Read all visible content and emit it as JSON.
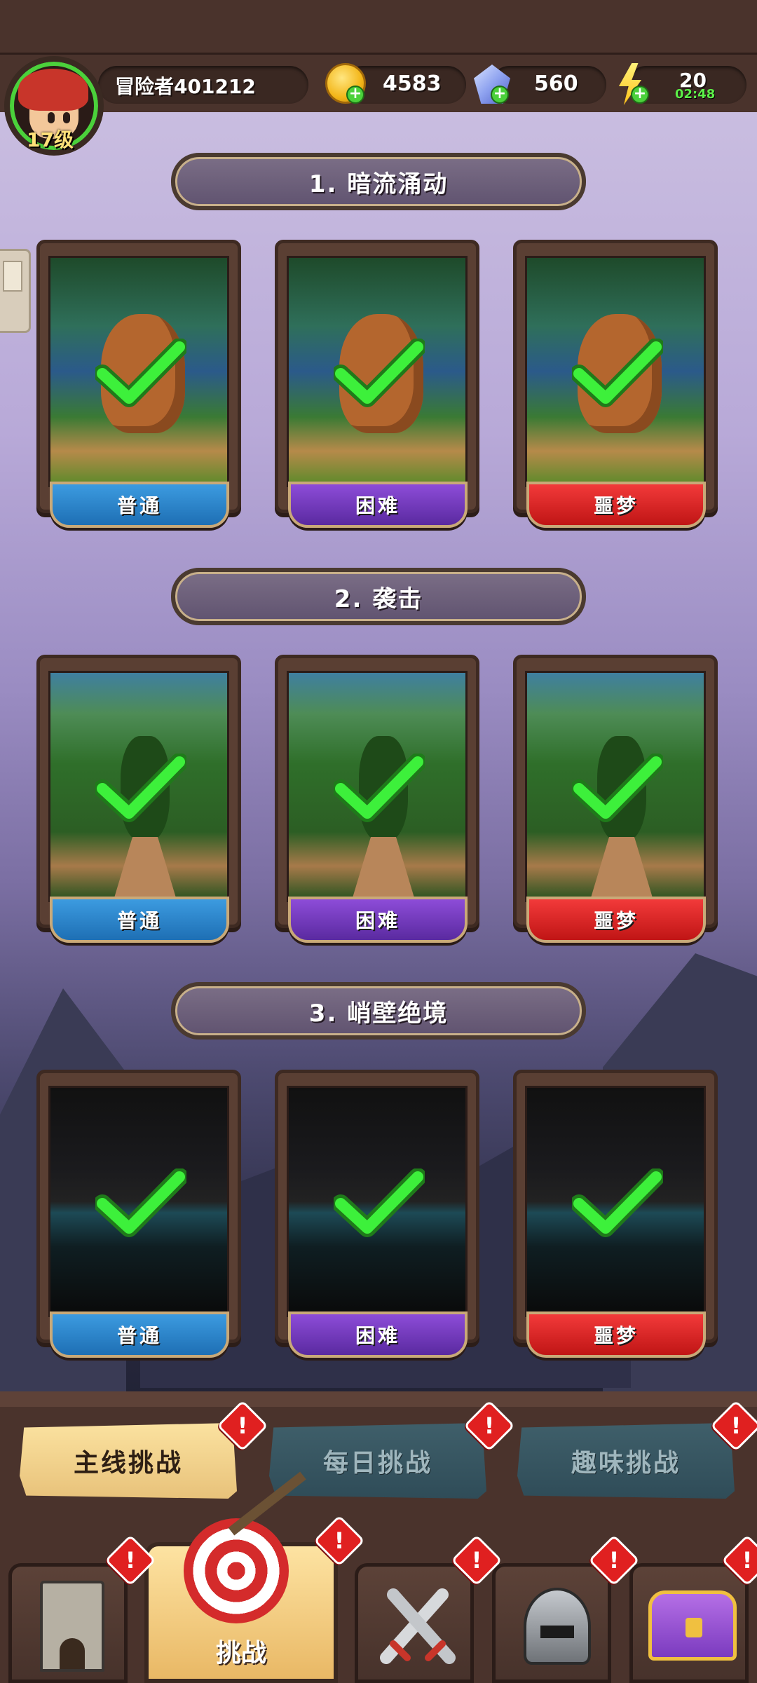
{
  "player": {
    "name": "冒险者401212",
    "level": "17级"
  },
  "currencies": {
    "gold": "4583",
    "gems": "560",
    "energy": "20",
    "energy_timer": "02:48"
  },
  "colors": {
    "normal": "#1e6fb4",
    "hard": "#5a2aa0",
    "nightmare": "#c01515",
    "check": "#3df03b",
    "alert": "#e02020"
  },
  "stages": [
    {
      "title": "1. 暗流涌动",
      "scene": "forest-dragon",
      "levels": [
        {
          "difficulty": "普通",
          "cleared": true
        },
        {
          "difficulty": "困难",
          "cleared": true
        },
        {
          "difficulty": "噩梦",
          "cleared": true
        }
      ]
    },
    {
      "title": "2. 袭击",
      "scene": "grass-bug",
      "levels": [
        {
          "difficulty": "普通",
          "cleared": true
        },
        {
          "difficulty": "困难",
          "cleared": true
        },
        {
          "difficulty": "噩梦",
          "cleared": true
        }
      ]
    },
    {
      "title": "3. 峭壁绝境",
      "scene": "cave",
      "levels": [
        {
          "difficulty": "普通",
          "cleared": true
        },
        {
          "difficulty": "困难",
          "cleared": true
        },
        {
          "difficulty": "噩梦",
          "cleared": true
        }
      ]
    }
  ],
  "sub_tabs": [
    {
      "label": "主线挑战",
      "active": true,
      "alert": "!"
    },
    {
      "label": "每日挑战",
      "active": false,
      "alert": "!"
    },
    {
      "label": "趣味挑战",
      "active": false,
      "alert": "!"
    }
  ],
  "bottom_nav": [
    {
      "icon": "tower-icon",
      "label": "",
      "alert": "!"
    },
    {
      "icon": "target-icon",
      "label": "挑战",
      "active": true,
      "alert": "!"
    },
    {
      "icon": "swords-icon",
      "label": "",
      "alert": "!"
    },
    {
      "icon": "helmet-icon",
      "label": "",
      "alert": "!"
    },
    {
      "icon": "chest-icon",
      "label": "",
      "alert": "!"
    }
  ]
}
